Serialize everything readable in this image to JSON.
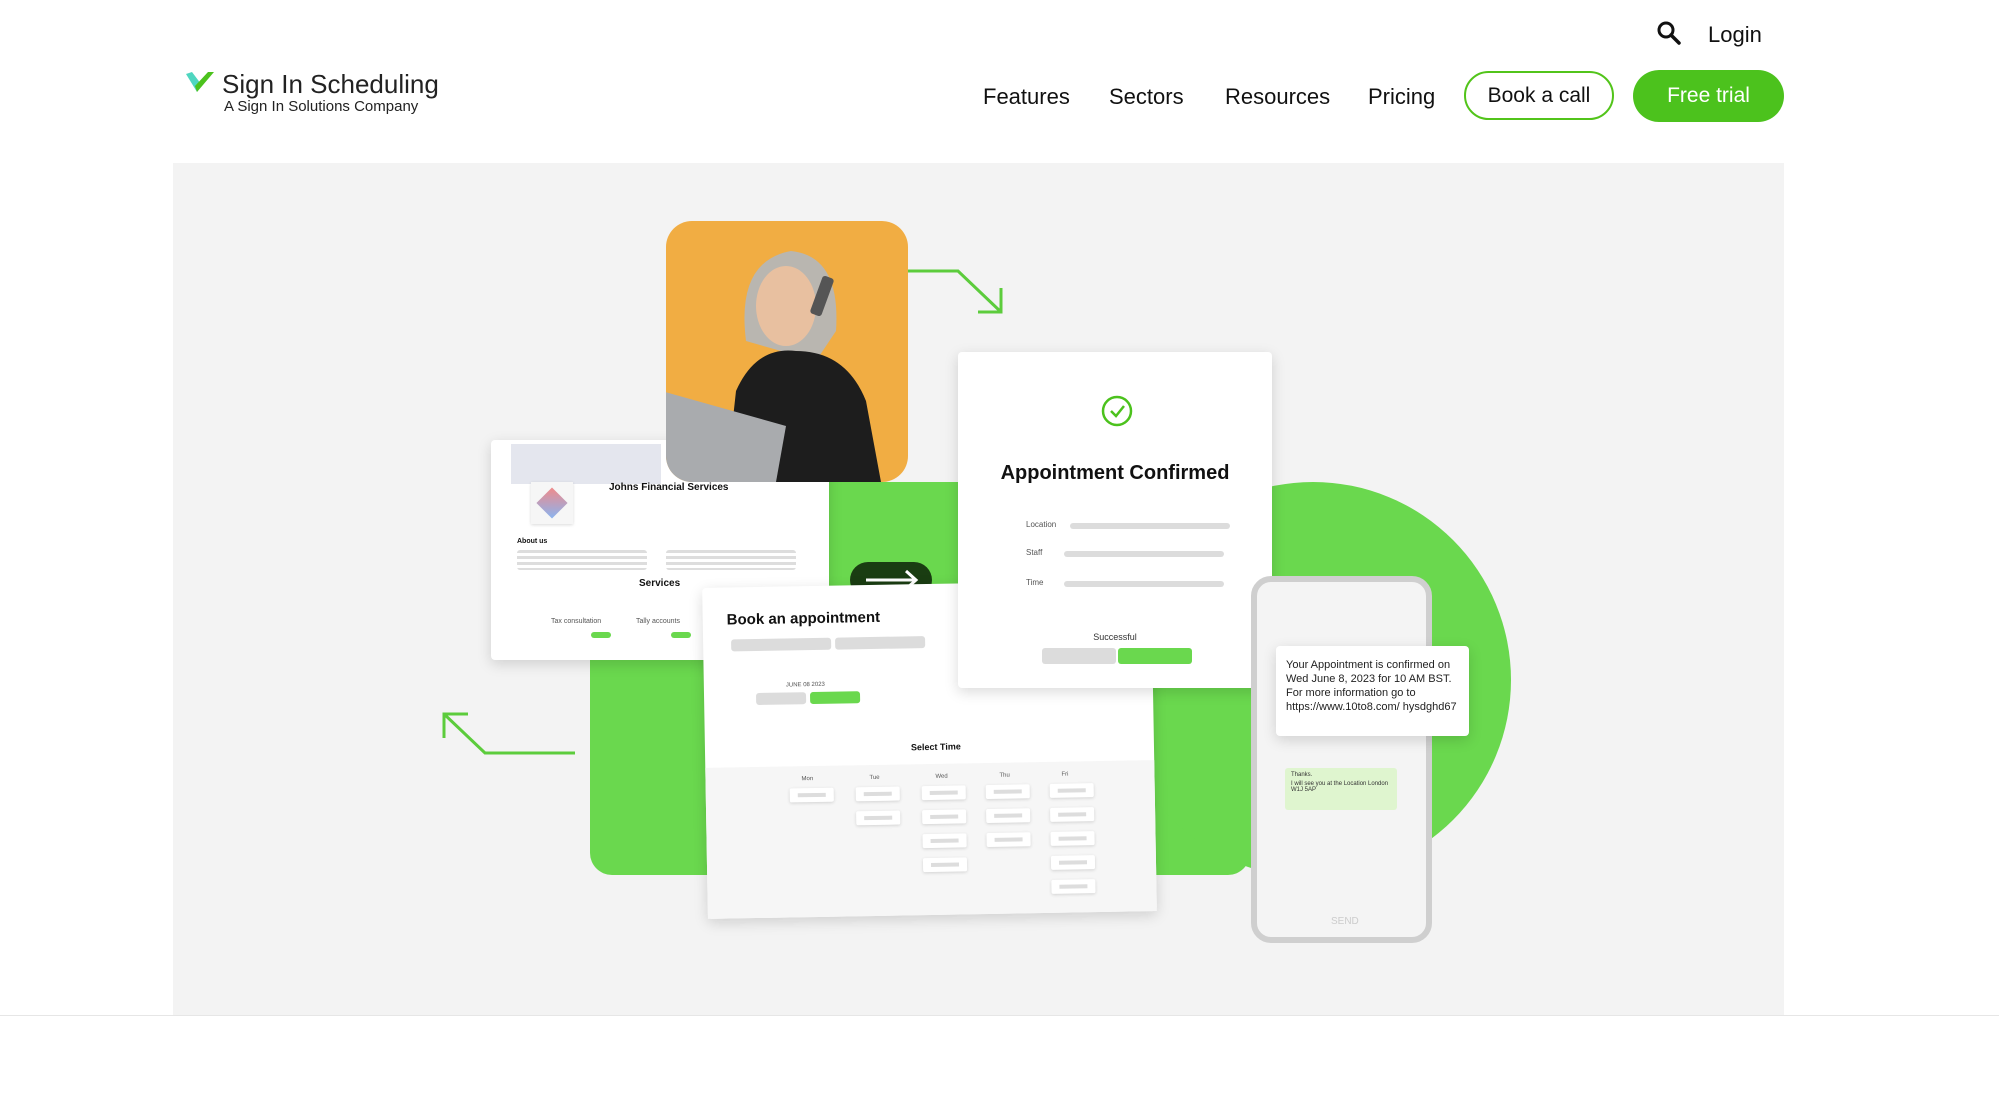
{
  "header": {
    "logo": {
      "title": "Sign In Scheduling",
      "subtitle": "A Sign In Solutions Company"
    },
    "login": "Login",
    "nav": [
      "Features",
      "Sectors",
      "Resources",
      "Pricing"
    ],
    "book_call": "Book a call",
    "free_trial": "Free trial",
    "colors": {
      "brand_green": "#4cc21d",
      "hero_bg": "#f3f3f3",
      "illustration_green": "#6ad84e",
      "photo_bg": "#f1ad43"
    }
  },
  "hero": {
    "business_card": {
      "name": "Johns Financial Services",
      "about": "About us",
      "services": "Services",
      "service_items": [
        "Tax consultation",
        "Tally accounts"
      ]
    },
    "booking_card": {
      "title": "Book an appointment",
      "date": "JUNE 08 2023",
      "select_time": "Select Time",
      "days": [
        "Mon",
        "Tue",
        "Wed",
        "Thu",
        "Fri"
      ]
    },
    "confirm_card": {
      "title": "Appointment Confirmed",
      "fields": [
        "Location",
        "Staff",
        "Time"
      ],
      "status": "Successful"
    },
    "phone": {
      "sms": "Your Appointment is confirmed on Wed June 8, 2023 for 10 AM BST. For more information go to https://www.10to8.com/ hysdghd67",
      "reply_1": "Thanks.",
      "reply_2": "I will see you at the Location London W1J 5AP",
      "send": "SEND"
    }
  }
}
